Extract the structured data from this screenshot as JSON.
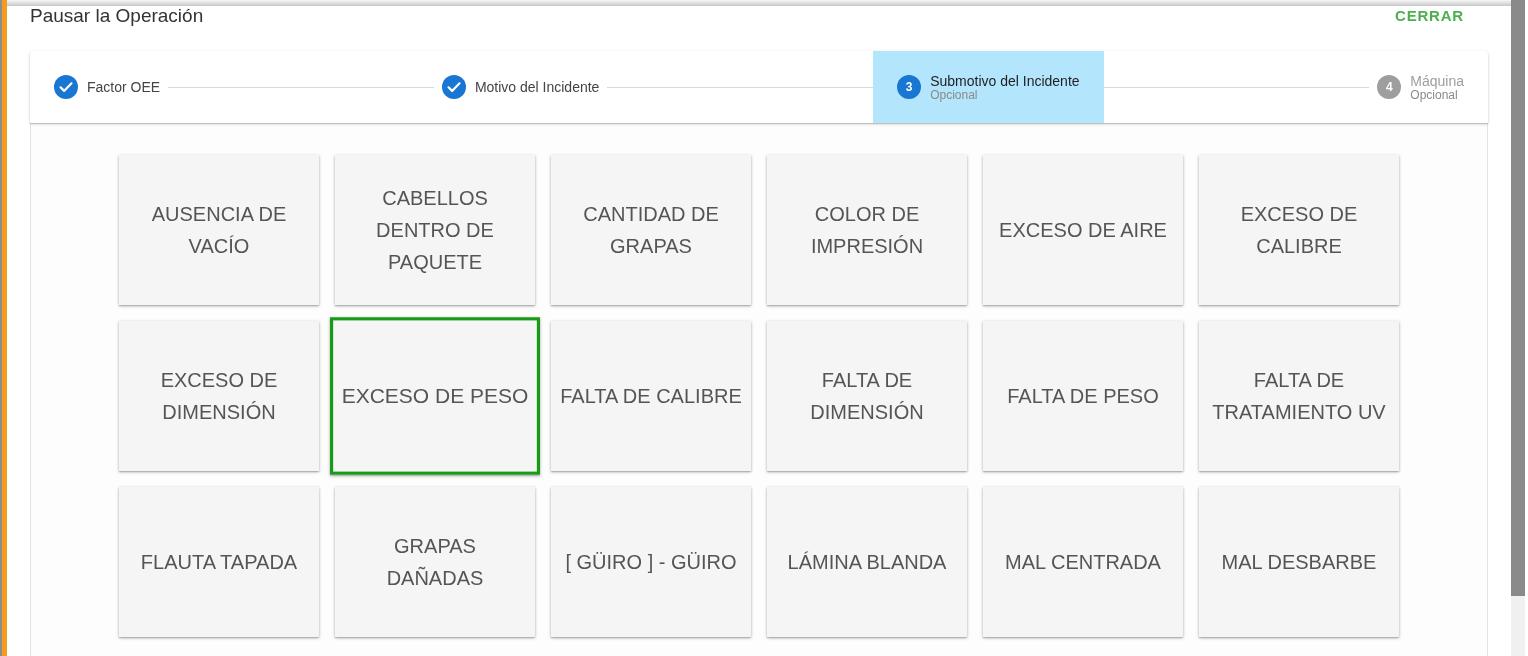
{
  "dialog": {
    "title": "Pausar la Operación",
    "close_button": "CERRAR"
  },
  "stepper": {
    "steps": [
      {
        "label": "Factor OEE",
        "completed": true,
        "selected": false
      },
      {
        "label": "Motivo del Incidente",
        "completed": true,
        "selected": false
      },
      {
        "number": "3",
        "label": "Submotivo del Incidente",
        "caption": "Opcional",
        "completed": false,
        "selected": true
      },
      {
        "number": "4",
        "label": "Máquina",
        "caption": "Opcional",
        "completed": false,
        "selected": false
      }
    ]
  },
  "options": [
    {
      "label": "AUSENCIA DE VACÍO",
      "selected": false
    },
    {
      "label": "CABELLOS DENTRO DE PAQUETE",
      "selected": false
    },
    {
      "label": "CANTIDAD DE GRAPAS",
      "selected": false
    },
    {
      "label": "COLOR DE IMPRESIÓN",
      "selected": false
    },
    {
      "label": "EXCESO DE AIRE",
      "selected": false
    },
    {
      "label": "EXCESO DE CALIBRE",
      "selected": false
    },
    {
      "label": "EXCESO DE DIMENSIÓN",
      "selected": false
    },
    {
      "label": "EXCESO DE PESO",
      "selected": true
    },
    {
      "label": "FALTA DE CALIBRE",
      "selected": false
    },
    {
      "label": "FALTA DE DIMENSIÓN",
      "selected": false
    },
    {
      "label": "FALTA DE PESO",
      "selected": false
    },
    {
      "label": "FALTA DE TRATAMIENTO UV",
      "selected": false
    },
    {
      "label": "FLAUTA TAPADA",
      "selected": false
    },
    {
      "label": "GRAPAS DAÑADAS",
      "selected": false
    },
    {
      "label": "[ GÜIRO ] - GÜIRO",
      "selected": false
    },
    {
      "label": "LÁMINA BLANDA",
      "selected": false
    },
    {
      "label": "MAL CENTRADA",
      "selected": false
    },
    {
      "label": "MAL DESBARBE",
      "selected": false
    }
  ]
}
